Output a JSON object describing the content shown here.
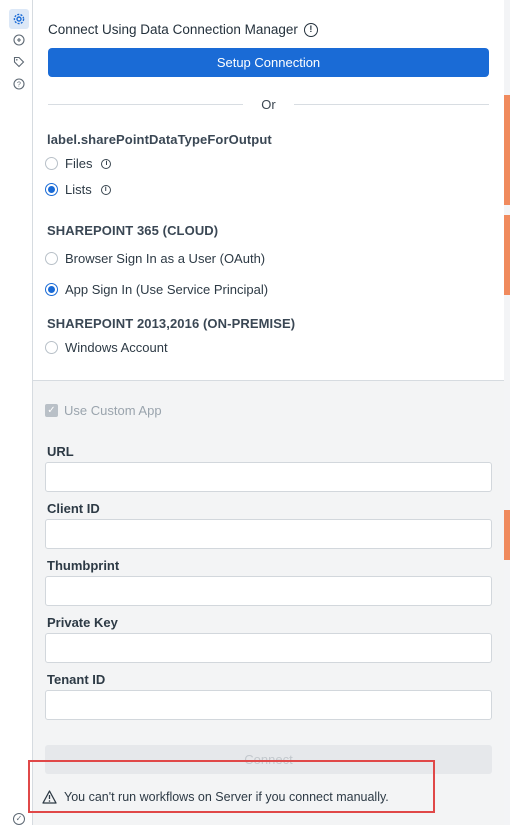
{
  "rail": {
    "icons": [
      "gear-icon",
      "connector-icon",
      "tag-icon",
      "help-icon"
    ],
    "active_color": "#1a6bd6"
  },
  "connection": {
    "title": "Connect Using Data Connection Manager",
    "info_glyph": "!",
    "setup_button": "Setup Connection",
    "or_text": "Or"
  },
  "output_type": {
    "label": "label.sharePointDataTypeForOutput",
    "options": [
      {
        "label": "Files",
        "checked": false,
        "info": "i"
      },
      {
        "label": "Lists",
        "checked": true,
        "info": "i"
      }
    ]
  },
  "cloud": {
    "label": "SHAREPOINT 365 (CLOUD)",
    "options": [
      {
        "label": "Browser Sign In as a User (OAuth)",
        "checked": false
      },
      {
        "label": "App Sign In (Use Service Principal)",
        "checked": true
      }
    ]
  },
  "onprem": {
    "label": "SHAREPOINT 2013,2016 (ON-PREMISE)",
    "options": [
      {
        "label": "Windows Account",
        "checked": false
      }
    ]
  },
  "custom_app": {
    "label": "Use Custom App",
    "checked": true,
    "check_glyph": "✓"
  },
  "fields": [
    {
      "label": "URL",
      "value": ""
    },
    {
      "label": "Client ID",
      "value": ""
    },
    {
      "label": "Thumbprint",
      "value": ""
    },
    {
      "label": "Private Key",
      "value": ""
    },
    {
      "label": "Tenant ID",
      "value": ""
    }
  ],
  "connect_button": "Connect",
  "warning": {
    "text": "You can't run workflows on Server if you connect manually.",
    "highlight_color": "#e04848"
  },
  "colors": {
    "primary": "#1a6bd6",
    "panel_bg": "#f3f4f5",
    "accent_strip": "#f08a5d"
  }
}
